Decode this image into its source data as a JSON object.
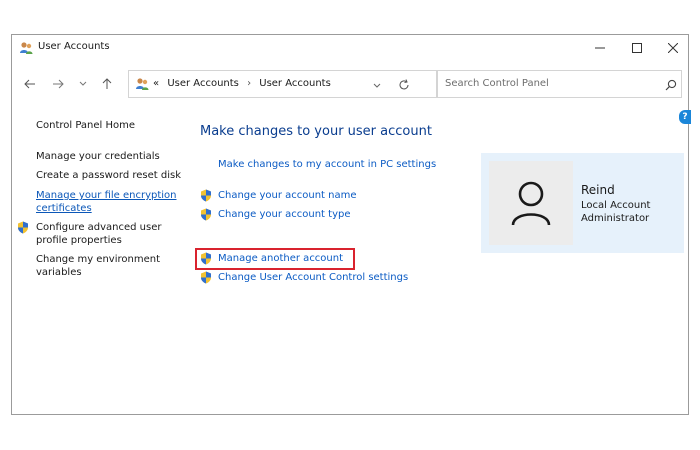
{
  "window": {
    "title": "User Accounts"
  },
  "address_bar": {
    "overflow": "«",
    "path": [
      "User Accounts",
      "User Accounts"
    ]
  },
  "search": {
    "placeholder": "Search Control Panel"
  },
  "left_nav": {
    "items": [
      "Control Panel Home",
      "Manage your credentials",
      "Create a password reset disk",
      "Manage your file encryption",
      "certificates",
      "Configure advanced user",
      "profile properties",
      "Change my environment",
      "variables"
    ]
  },
  "main": {
    "heading": "Make changes to your user account",
    "pc_settings_link": "Make changes to my account in PC settings",
    "links": [
      "Change your account name",
      "Change your account type",
      "Manage another account",
      "Change User Account Control settings"
    ]
  },
  "user": {
    "name": "Reind",
    "account_type": "Local Account",
    "role": "Administrator"
  },
  "colors": {
    "link": "#0b5bc4",
    "heading": "#0a3d8f",
    "highlight": "#d9232e",
    "user_card_bg": "#e6f1fb"
  },
  "icons": {
    "title": "users-icon",
    "shield": "uac-shield-icon",
    "avatar": "person-icon"
  }
}
